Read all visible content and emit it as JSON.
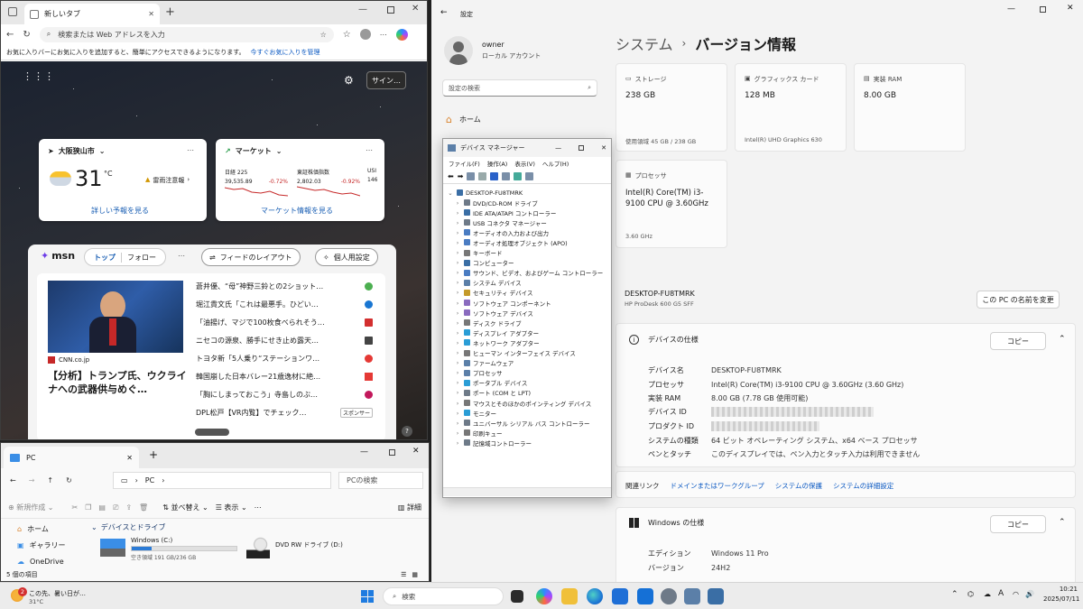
{
  "edge": {
    "tab_title": "新しいタブ",
    "address_placeholder": "検索または Web アドレスを入力",
    "favbar_text": "お気に入りバーにお気に入りを追加すると、簡単にアクセスできるようになります。",
    "favbar_link": "今すぐお気に入りを管理",
    "sign_in": "サイン…",
    "weather": {
      "location": "大阪狭山市",
      "temp": "31",
      "unit": "°C",
      "alert": "雷雨注意報",
      "link": "詳しい予報を見る"
    },
    "market": {
      "title": "マーケット",
      "items": [
        {
          "name": "日経 225",
          "value": "39,535.89",
          "change": "-0.72%"
        },
        {
          "name": "東証株価指数",
          "value": "2,802.03",
          "change": "-0.92%"
        },
        {
          "name": "USI",
          "value": "146",
          "change": ""
        }
      ],
      "link": "マーケット情報を見る"
    },
    "msn": {
      "logo": "msn",
      "tab_top": "トップ",
      "tab_follow": "フォロー",
      "layout_button": "フィードのレイアウト",
      "personal_button": "個人用設定",
      "source": "CNN.co.jp",
      "headline": "【分析】トランプ氏、ウクライナへの武器供与めぐ…",
      "news": [
        "蒼井優、“母”神野三鈴との2ショット…",
        "堀江貴文氏「これは最悪手。ひどい…",
        "「油揚げ、マジで100枚食べられそう…",
        "ニセコの源泉、勝手にせき止め露天…",
        "トヨタ新「5人乗り“ステーションワ…",
        "韓国崩した日本バレー21歳逸材に絶…",
        "「胸にしまっておこう」寺島しのぶ…",
        "DPL松戸【VR内覧】でチェック…"
      ],
      "sponsor": "スポンサー"
    }
  },
  "explorer": {
    "tab_title": "PC",
    "crumb": "PC",
    "search_placeholder": "PCの検索",
    "cmd": {
      "new": "新規作成",
      "sort": "並べ替え",
      "view": "表示",
      "details": "詳細"
    },
    "sidebar": [
      "ホーム",
      "ギャラリー",
      "OneDrive"
    ],
    "group_title": "デバイスとドライブ",
    "drives": [
      {
        "name": "Windows (C:)",
        "info": "空き領域 191 GB/236 GB",
        "used_fraction": 0.19
      },
      {
        "name": "DVD RW ドライブ (D:)",
        "info": ""
      }
    ],
    "status": "5 個の項目"
  },
  "settings": {
    "app_title": "設定",
    "user_name": "owner",
    "user_type": "ローカル アカウント",
    "search_placeholder": "設定の検索",
    "nav_home": "ホーム",
    "breadcrumb_parent": "システム",
    "breadcrumb_current": "バージョン情報",
    "tiles": {
      "storage": {
        "label": "ストレージ",
        "value": "238 GB",
        "sub": "使用領域 45 GB / 238 GB"
      },
      "graphics": {
        "label": "グラフィックス カード",
        "value": "128 MB",
        "sub": "Intel(R) UHD Graphics 630"
      },
      "ram": {
        "label": "実装 RAM",
        "value": "8.00 GB",
        "sub": ""
      },
      "cpu": {
        "label": "プロセッサ",
        "value": "Intel(R) Core(TM) i3-9100 CPU @ 3.60GHz",
        "sub": "3.60 GHz"
      }
    },
    "pc_name": "DESKTOP-FU8TMRK",
    "pc_model": "HP ProDesk 600 G5 SFF",
    "rename_button": "この PC の名前を変更",
    "device_spec_title": "デバイスの仕様",
    "copy_button": "コピー",
    "specs": [
      {
        "k": "デバイス名",
        "v": "DESKTOP-FU8TMRK"
      },
      {
        "k": "プロセッサ",
        "v": "Intel(R) Core(TM) i3-9100 CPU @ 3.60GHz (3.60 GHz)"
      },
      {
        "k": "実装 RAM",
        "v": "8.00 GB (7.78 GB 使用可能)"
      },
      {
        "k": "デバイス ID",
        "v": ""
      },
      {
        "k": "プロダクト ID",
        "v": ""
      },
      {
        "k": "システムの種類",
        "v": "64 ビット オペレーティング システム、x64 ベース プロセッサ"
      },
      {
        "k": "ペンとタッチ",
        "v": "このディスプレイでは、ペン入力とタッチ入力は利用できません"
      }
    ],
    "related_label": "関連リンク",
    "related_links": [
      "ドメインまたはワークグループ",
      "システムの保護",
      "システムの詳細設定"
    ],
    "windows_spec_title": "Windows の仕様",
    "win_specs": [
      {
        "k": "エディション",
        "v": "Windows 11 Pro"
      },
      {
        "k": "バージョン",
        "v": "24H2"
      }
    ]
  },
  "devmgr": {
    "title": "デバイス マネージャー",
    "menu": [
      "ファイル(F)",
      "操作(A)",
      "表示(V)",
      "ヘルプ(H)"
    ],
    "root": "DESKTOP-FU8TMRK",
    "items": [
      "DVD/CD-ROM ドライブ",
      "IDE ATA/ATAPI コントローラー",
      "USB コネクタ マネージャー",
      "オーディオの入力および出力",
      "オーディオ処理オブジェクト (APO)",
      "キーボード",
      "コンピューター",
      "サウンド、ビデオ、およびゲーム コントローラー",
      "システム デバイス",
      "セキュリティ デバイス",
      "ソフトウェア コンポーネント",
      "ソフトウェア デバイス",
      "ディスク ドライブ",
      "ディスプレイ アダプター",
      "ネットワーク アダプター",
      "ヒューマン インターフェイス デバイス",
      "ファームウェア",
      "プロセッサ",
      "ポータブル デバイス",
      "ポート (COM と LPT)",
      "マウスとそのほかのポインティング デバイス",
      "モニター",
      "ユニバーサル シリアル バス コントローラー",
      "印刷キュー",
      "記憶域コントローラー"
    ]
  },
  "taskbar": {
    "weather_text": "この先、暑い日が…",
    "weather_temp": "31°C",
    "badge": "2",
    "search_placeholder": "検索",
    "ime": "A",
    "time": "10:21",
    "date": "2025/07/11"
  }
}
